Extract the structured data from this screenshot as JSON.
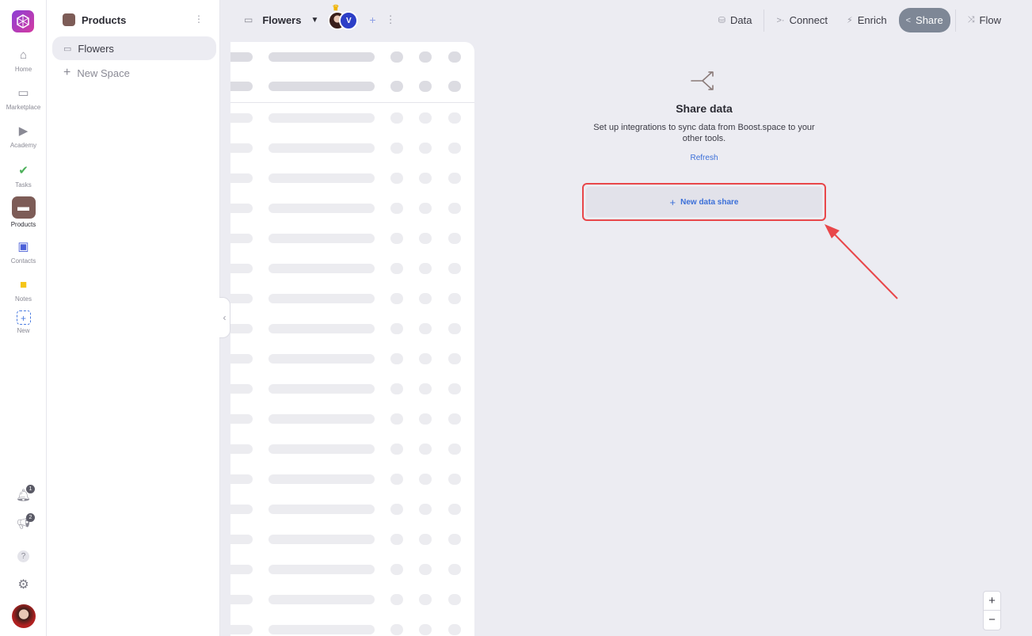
{
  "rail": {
    "items": [
      {
        "label": "Home",
        "icon": "home-icon"
      },
      {
        "label": "Marketplace",
        "icon": "store-icon"
      },
      {
        "label": "Academy",
        "icon": "play-icon"
      },
      {
        "label": "Tasks",
        "icon": "check-icon"
      },
      {
        "label": "Products",
        "icon": "box-icon"
      },
      {
        "label": "Contacts",
        "icon": "contact-card-icon"
      },
      {
        "label": "Notes",
        "icon": "note-icon"
      },
      {
        "label": "New",
        "icon": "plus-icon"
      }
    ],
    "notifications_count": "1",
    "announcements_count": "2"
  },
  "sidebar": {
    "title": "Products",
    "items": [
      {
        "label": "Flowers"
      },
      {
        "label": "New Space"
      }
    ]
  },
  "topbar": {
    "space_name": "Flowers",
    "avatar_initial": "V",
    "nav": [
      {
        "label": "Data",
        "icon": "database-icon"
      },
      {
        "label": "Connect",
        "icon": "connect-icon"
      },
      {
        "label": "Enrich",
        "icon": "enrich-icon"
      },
      {
        "label": "Share",
        "icon": "share-icon",
        "active": true
      },
      {
        "label": "Flow",
        "icon": "flow-icon"
      }
    ]
  },
  "share_panel": {
    "title": "Share data",
    "description": "Set up integrations to sync data from Boost.space to your other tools.",
    "refresh_label": "Refresh",
    "new_share_label": "New data share"
  },
  "zoom": {
    "in": "+",
    "out": "−"
  },
  "colors": {
    "accent": "#3b6fd8",
    "highlight": "#e8474a",
    "active_nav": "#7e8796",
    "products": "#7d5c57"
  }
}
